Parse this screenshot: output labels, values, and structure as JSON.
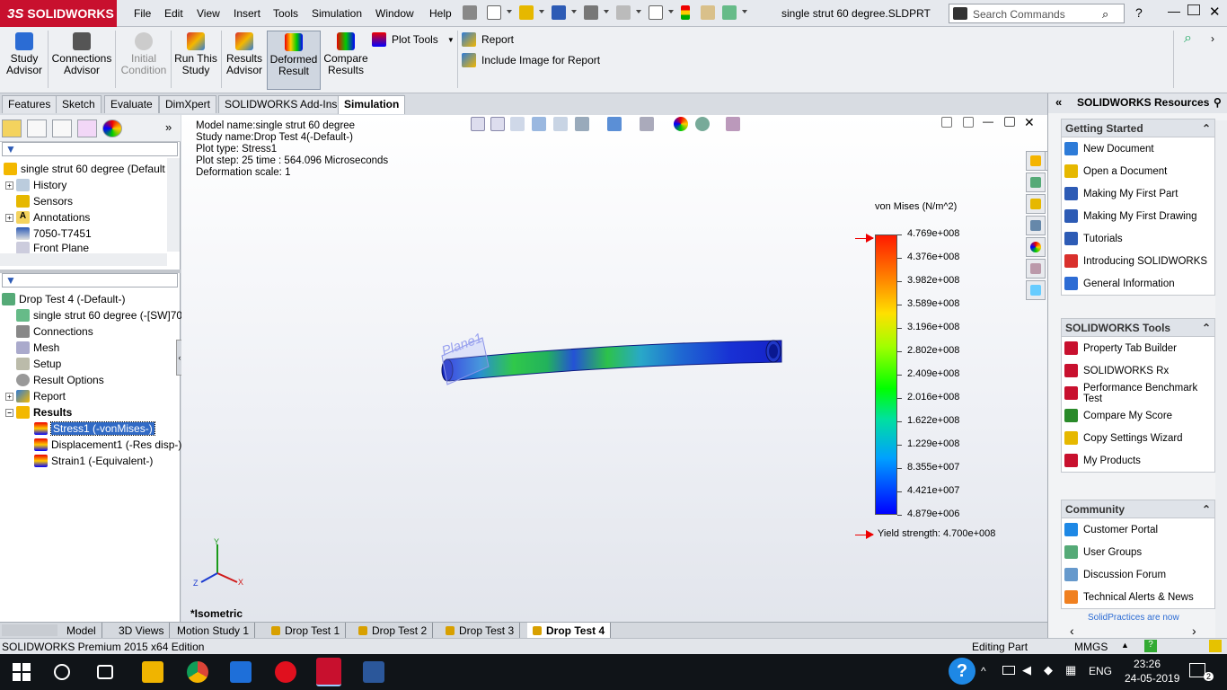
{
  "titlebar": {
    "brand": "SOLIDWORKS",
    "brand_prefix": "3S",
    "menus": [
      "File",
      "Edit",
      "View",
      "Insert",
      "Tools",
      "Simulation",
      "Window",
      "Help"
    ],
    "document_title": "single strut 60 degree.SLDPRT",
    "search_placeholder": "Search Commands"
  },
  "commandmanager": {
    "buttons": [
      {
        "label": "Study\nAdvisor",
        "color": "#2b6cd4"
      },
      {
        "label": "Connections\nAdvisor",
        "color": "#444"
      },
      {
        "label": "Initial\nCondition",
        "color": "#aaa"
      },
      {
        "label": "Run This\nStudy",
        "color": "#d9302c"
      },
      {
        "label": "Results\nAdvisor",
        "color": "#d9302c"
      },
      {
        "label": "Deformed\nResult",
        "color": "#2d7bd8"
      },
      {
        "label": "Compare\nResults",
        "color": "#2d7bd8"
      }
    ],
    "plot_tools": "Plot Tools",
    "report": "Report",
    "include_image": "Include Image for Report"
  },
  "tabs": [
    "Features",
    "Sketch",
    "Evaluate",
    "DimXpert",
    "SOLIDWORKS Add-Ins",
    "Simulation"
  ],
  "featuretree": {
    "root": "single strut 60 degree  (Default",
    "items": [
      "History",
      "Sensors",
      "Annotations",
      "7050-T7451",
      "Front Plane"
    ]
  },
  "simtree": {
    "root": "Drop Test 4 (-Default-)",
    "items": [
      "single strut 60 degree (-[SW]70",
      "Connections",
      "Mesh",
      "Setup",
      "Result Options",
      "Report",
      "Results"
    ],
    "results": [
      "Stress1 (-vonMises-)",
      "Displacement1 (-Res disp-)",
      "Strain1 (-Equivalent-)"
    ]
  },
  "viewport": {
    "info": [
      "Model name:single strut 60 degree",
      "Study name:Drop Test 4(-Default-)",
      "Plot type:  Stress1",
      "Plot step: 25   time : 564.096 Microseconds",
      "Deformation scale: 1"
    ],
    "plane_label": "Plane1",
    "legend_title": "von Mises (N/m^2)",
    "legend_ticks": [
      "4.769e+008",
      "4.376e+008",
      "3.982e+008",
      "3.589e+008",
      "3.196e+008",
      "2.802e+008",
      "2.409e+008",
      "2.016e+008",
      "1.622e+008",
      "1.229e+008",
      "8.355e+007",
      "4.421e+007",
      "4.879e+006"
    ],
    "yield": "Yield strength: 4.700e+008",
    "view_name": "*Isometric",
    "triad": {
      "y": "Y",
      "x": "X",
      "z": "Z"
    }
  },
  "taskpane": {
    "title": "SOLIDWORKS Resources",
    "sections": [
      {
        "title": "Getting Started",
        "items": [
          "New Document",
          "Open a Document",
          "Making My First Part",
          "Making My First Drawing",
          "Tutorials",
          "Introducing SOLIDWORKS",
          "General Information"
        ]
      },
      {
        "title": "SOLIDWORKS Tools",
        "items": [
          "Property Tab Builder",
          "SOLIDWORKS Rx",
          "Performance Benchmark Test",
          "Compare My Score",
          "Copy Settings Wizard",
          "My Products"
        ]
      },
      {
        "title": "Community",
        "items": [
          "Customer Portal",
          "User Groups",
          "Discussion Forum",
          "Technical Alerts & News"
        ]
      }
    ],
    "footer": "SolidPractices are now"
  },
  "bottomtabs": [
    "Model",
    "3D Views",
    "Motion Study 1",
    "Drop Test 1",
    "Drop Test 2",
    "Drop Test 3",
    "Drop Test 4"
  ],
  "status": {
    "edition": "SOLIDWORKS Premium 2015 x64 Edition",
    "mode": "Editing Part",
    "units": "MMGS"
  },
  "taskbar": {
    "lang": "ENG",
    "time": "23:26",
    "date": "24-05-2019",
    "notif": "2"
  }
}
